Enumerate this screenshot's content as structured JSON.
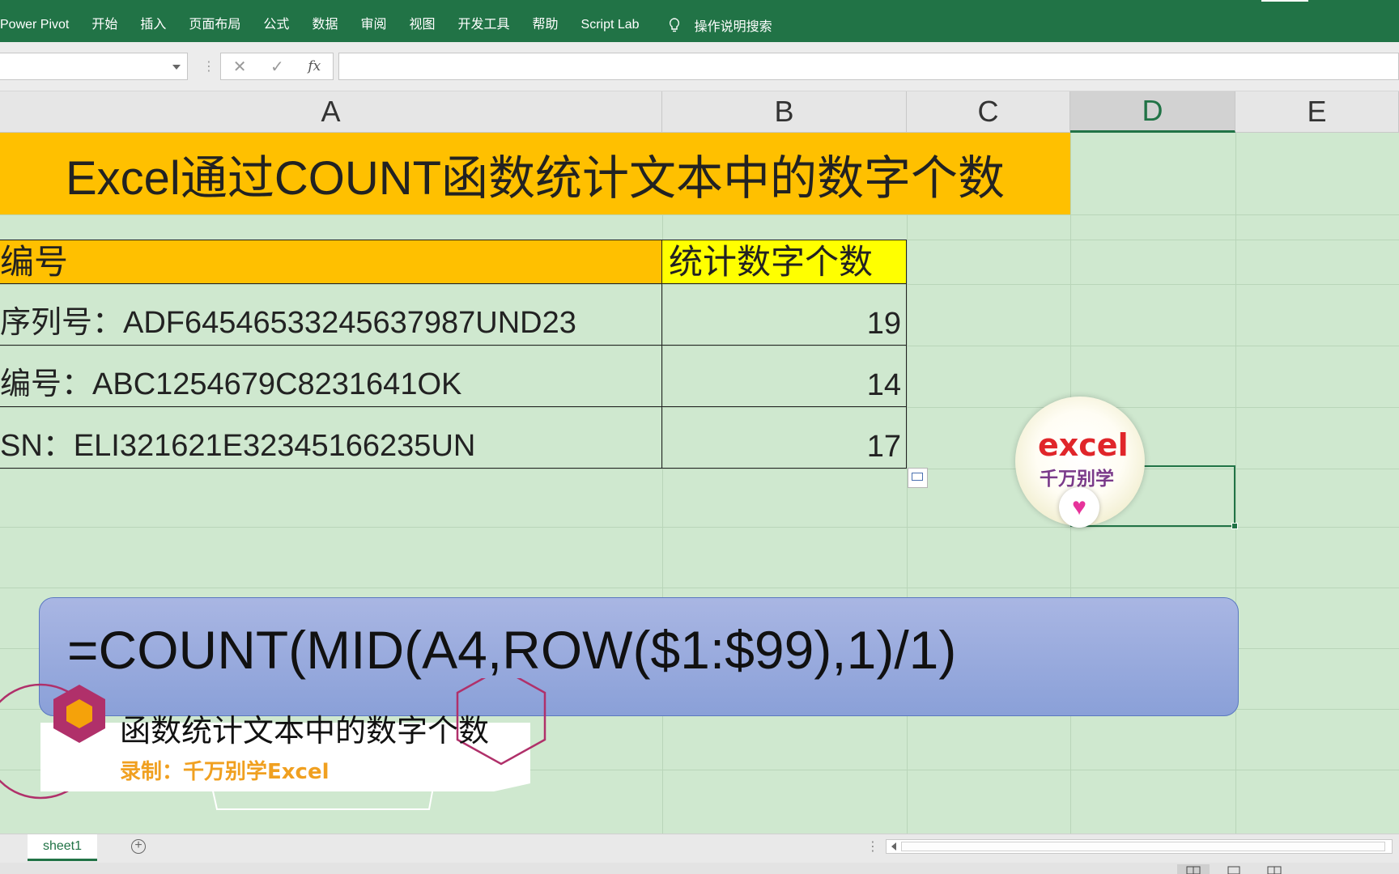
{
  "ribbon": {
    "tabs": [
      "Power Pivot",
      "开始",
      "插入",
      "页面布局",
      "公式",
      "数据",
      "审阅",
      "视图",
      "开发工具",
      "帮助",
      "Script Lab"
    ],
    "search_label": "操作说明搜索"
  },
  "formula_bar": {
    "name_box": "",
    "formula": "",
    "fx_label": "fx",
    "cancel_glyph": "✕",
    "enter_glyph": "✓"
  },
  "columns": [
    "A",
    "B",
    "C",
    "D",
    "E"
  ],
  "selected_column": "D",
  "sheet": {
    "title": "Excel通过COUNT函数统计文本中的数字个数",
    "header_a": "编号",
    "header_b": "统计数字个数",
    "rows": [
      {
        "a": "序列号：ADF64546533245637987UND23",
        "b": "19"
      },
      {
        "a": "编号：ABC1254679C8231641OK",
        "b": "14"
      },
      {
        "a": "SN：ELI321621E32345166235UN",
        "b": "17"
      }
    ]
  },
  "overlay": {
    "formula": "=COUNT(MID(A4,ROW($1:$99),1)/1)",
    "caption_title": "函数统计文本中的数字个数",
    "caption_sub": "录制：千万别学Excel"
  },
  "logo": {
    "line1": "excel",
    "line2": "千万别学"
  },
  "sheet_tabs": [
    "sheet1"
  ],
  "colors": {
    "ribbon": "#217346",
    "title_fill": "#ffc000",
    "header_b_fill": "#ffff00",
    "grid_bg": "#cfe8cf",
    "banner": "#8aa0d8",
    "caption_orange": "#f0a020",
    "hex_magenta": "#b0306a"
  }
}
